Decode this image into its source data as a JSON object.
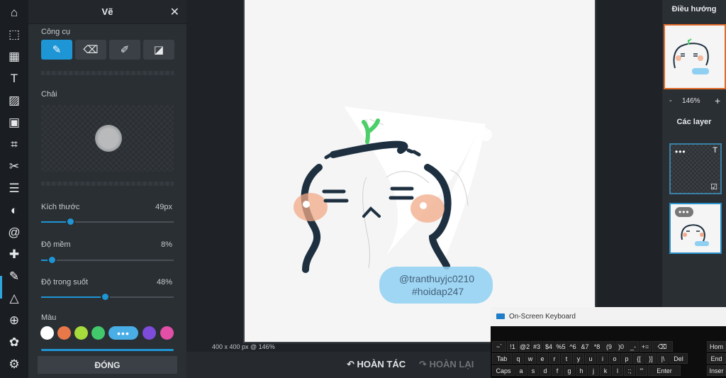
{
  "toolbar": {
    "tools": [
      {
        "name": "home-icon",
        "glyph": "⌂"
      },
      {
        "name": "select-icon",
        "glyph": "⬚"
      },
      {
        "name": "layout-icon",
        "glyph": "▦"
      },
      {
        "name": "text-icon",
        "glyph": "T"
      },
      {
        "name": "texture-icon",
        "glyph": "▨"
      },
      {
        "name": "image-icon",
        "glyph": "▣"
      },
      {
        "name": "crop-icon",
        "glyph": "⌗"
      },
      {
        "name": "cutout-icon",
        "glyph": "✂"
      },
      {
        "name": "adjust-icon",
        "glyph": "☰"
      },
      {
        "name": "contrast-icon",
        "glyph": "◐"
      },
      {
        "name": "spiral-icon",
        "glyph": "@"
      },
      {
        "name": "healing-icon",
        "glyph": "✚"
      },
      {
        "name": "brush-icon",
        "glyph": "✎"
      },
      {
        "name": "shape-icon",
        "glyph": "△"
      },
      {
        "name": "pattern-icon",
        "glyph": "⊕"
      },
      {
        "name": "sticker-icon",
        "glyph": "✿"
      },
      {
        "name": "settings-icon",
        "glyph": "⚙"
      }
    ]
  },
  "panel": {
    "title": "Vẽ",
    "close_glyph": "✕",
    "tools_label": "Công cụ",
    "tool_buttons": [
      {
        "name": "brush-tool-icon",
        "glyph": "✎",
        "selected": true
      },
      {
        "name": "eraser-tool-icon",
        "glyph": "⌫",
        "selected": false
      },
      {
        "name": "picker-tool-icon",
        "glyph": "✐",
        "selected": false
      },
      {
        "name": "fill-tool-icon",
        "glyph": "◪",
        "selected": false
      }
    ],
    "brush_label": "Chải",
    "size_label": "Kích thước",
    "size_value": "49px",
    "size_fraction": 0.22,
    "softness_label": "Độ mềm",
    "softness_value": "8%",
    "softness_fraction": 0.08,
    "opacity_label": "Độ trong suốt",
    "opacity_value": "48%",
    "opacity_fraction": 0.48,
    "color_label": "Màu",
    "colors": [
      "#ffffff",
      "#e8784a",
      "#a6dc3c",
      "#42c96b",
      "#7d4cdb",
      "#e14fa6"
    ],
    "more_colors": "•••",
    "close_button": "ĐÓNG"
  },
  "canvas": {
    "watermark_line1": "@tranthuyjc0210",
    "watermark_line2": "#hoidap247",
    "status": "400 x 400 px @ 146%"
  },
  "actions": {
    "undo": "↶ HOÀN TÁC",
    "redo": "↷ HOÀN LẠI"
  },
  "right": {
    "navigator_title": "Điều hướng",
    "zoom_minus": "-",
    "zoom_value": "146%",
    "zoom_plus": "+",
    "layers_title": "Các layer",
    "layer_dots": "•••",
    "layer_text_icon": "T",
    "layer_check_icon": "☑"
  },
  "osk": {
    "title": "On-Screen Keyboard",
    "row1": [
      "~`",
      "!1",
      "@2",
      "#3",
      "$4",
      "%5",
      "^6",
      "&7",
      "*8",
      "(9",
      ")0",
      "_-",
      "+=",
      "⌫"
    ],
    "row2": [
      "Tab",
      "q",
      "w",
      "e",
      "r",
      "t",
      "y",
      "u",
      "i",
      "o",
      "p",
      "{[",
      "}]",
      "|\\",
      "Del"
    ],
    "row3": [
      "Caps",
      "a",
      "s",
      "d",
      "f",
      "g",
      "h",
      "j",
      "k",
      "l",
      ":;",
      "\"'",
      "Enter"
    ],
    "side": [
      "Hom",
      "End",
      "Inser"
    ]
  }
}
